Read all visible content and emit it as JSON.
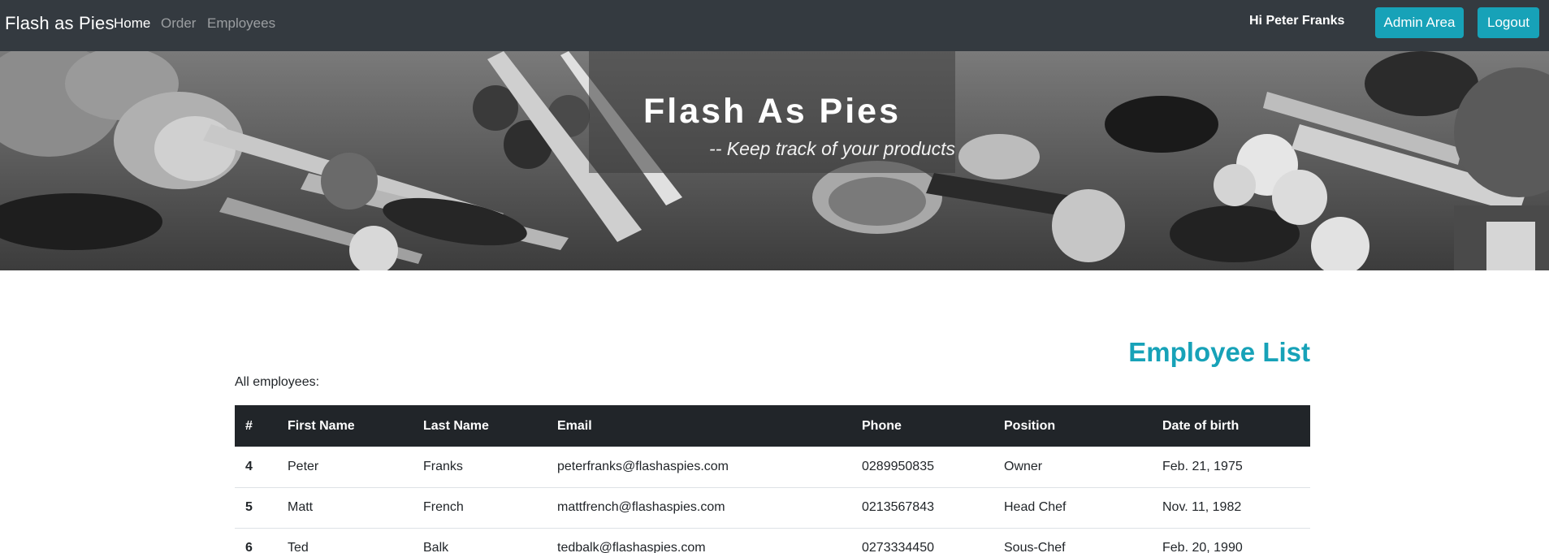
{
  "navbar": {
    "brand": "Flash as Pies",
    "links": [
      {
        "label": "Home"
      },
      {
        "label": "Order"
      },
      {
        "label": "Employees"
      }
    ],
    "greeting": "Hi Peter Franks",
    "admin_button": "Admin Area",
    "logout_button": "Logout"
  },
  "hero": {
    "title": "Flash As Pies",
    "subtitle": "-- Keep track of your products"
  },
  "main": {
    "heading": "Employee List",
    "intro": "All employees:",
    "table": {
      "headers": [
        "#",
        "First Name",
        "Last Name",
        "Email",
        "Phone",
        "Position",
        "Date of birth"
      ],
      "rows": [
        [
          "4",
          "Peter",
          "Franks",
          "peterfranks@flashaspies.com",
          "0289950835",
          "Owner",
          "Feb. 21, 1975"
        ],
        [
          "5",
          "Matt",
          "French",
          "mattfrench@flashaspies.com",
          "0213567843",
          "Head Chef",
          "Nov. 11, 1982"
        ],
        [
          "6",
          "Ted",
          "Balk",
          "tedbalk@flashaspies.com",
          "0273334450",
          "Sous-Chef",
          "Feb. 20, 1990"
        ]
      ]
    }
  },
  "colors": {
    "navbar_bg": "#343a40",
    "accent": "#17a2b8",
    "table_header_bg": "#212529"
  }
}
